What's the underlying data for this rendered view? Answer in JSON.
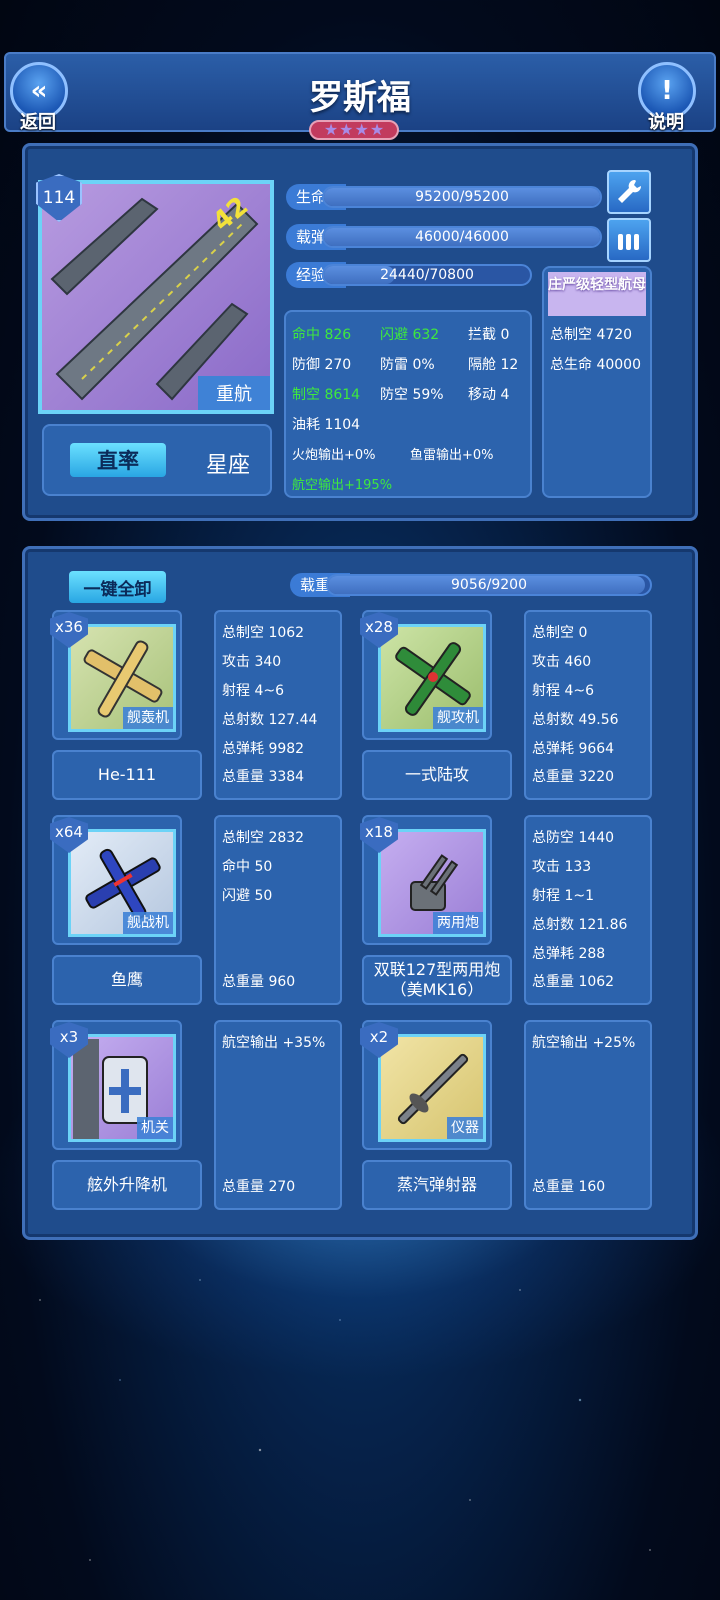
{
  "header": {
    "title": "罗斯福",
    "back_label": "返回",
    "help_label": "说明",
    "rating_stars": 4
  },
  "ship": {
    "level": "114",
    "type_tag": "重航",
    "hull_number": "42",
    "btn_ratio": "直率",
    "btn_constellation": "星座",
    "stats": {
      "hp_label": "生命",
      "hp_value": "95200/95200",
      "hp_fraction": 1.0,
      "ammo_label": "载弹",
      "ammo_value": "46000/46000",
      "ammo_fraction": 1.0,
      "exp_label": "经验",
      "exp_value": "24440/70800",
      "exp_fraction": 0.345
    },
    "attrs": {
      "hit": "命中 826",
      "dodge": "闪避 632",
      "intercept": "拦截 0",
      "defense": "防御 270",
      "torpedo_def": "防雷 0%",
      "bulkhead": "隔舱 12",
      "air_control": "制空 8614",
      "aa": "防空 59%",
      "move": "移动 4",
      "fuel": "油耗 1104",
      "gun_output": "火炮输出+0%",
      "torp_output": "鱼雷输出+0%",
      "air_output": "航空输出+195%"
    },
    "class_box": {
      "title": "庄严级轻型航母",
      "total_air": "总制空 4720",
      "total_hp": "总生命 40000"
    }
  },
  "equipment": {
    "unload_all": "一键全卸",
    "load_label": "载重",
    "load_value": "9056/9200",
    "load_fraction": 0.984,
    "slots": [
      {
        "qty": "x36",
        "tag": "舰轰机",
        "name": "He-111",
        "lines": [
          {
            "t": "总制空 1062",
            "c": "green"
          },
          {
            "t": "攻击 340",
            "c": ""
          },
          {
            "t": "射程 4~6",
            "c": ""
          },
          {
            "t": "总射数 127.44",
            "c": "green"
          },
          {
            "t": "总弹耗 9982",
            "c": "red"
          },
          {
            "t": "总重量 3384",
            "c": ""
          }
        ]
      },
      {
        "qty": "x28",
        "tag": "舰攻机",
        "name": "一式陆攻",
        "lines": [
          {
            "t": "总制空 0",
            "c": "green"
          },
          {
            "t": "攻击 460",
            "c": ""
          },
          {
            "t": "射程 4~6",
            "c": ""
          },
          {
            "t": "总射数 49.56",
            "c": "green"
          },
          {
            "t": "总弹耗 9664",
            "c": "red"
          },
          {
            "t": "总重量 3220",
            "c": ""
          }
        ]
      },
      {
        "qty": "x64",
        "tag": "舰战机",
        "name": "鱼鹰",
        "lines": [
          {
            "t": "总制空 2832",
            "c": "green"
          },
          {
            "t": "命中 50",
            "c": ""
          },
          {
            "t": "闪避 50",
            "c": ""
          },
          {
            "t": "",
            "c": ""
          },
          {
            "t": "",
            "c": ""
          },
          {
            "t": "总重量 960",
            "c": ""
          }
        ]
      },
      {
        "qty": "x18",
        "tag": "两用炮",
        "name": "双联127型两用炮（美MK16）",
        "lines": [
          {
            "t": "总防空 1440",
            "c": ""
          },
          {
            "t": "攻击 133",
            "c": ""
          },
          {
            "t": "射程 1~1",
            "c": ""
          },
          {
            "t": "总射数 121.86",
            "c": ""
          },
          {
            "t": "总弹耗 288",
            "c": ""
          },
          {
            "t": "总重量 1062",
            "c": ""
          }
        ]
      },
      {
        "qty": "x3",
        "tag": "机关",
        "name": "舷外升降机",
        "lines": [
          {
            "t": "航空输出 +35%",
            "c": ""
          },
          {
            "t": "",
            "c": ""
          },
          {
            "t": "",
            "c": ""
          },
          {
            "t": "",
            "c": ""
          },
          {
            "t": "",
            "c": ""
          },
          {
            "t": "总重量 270",
            "c": ""
          }
        ]
      },
      {
        "qty": "x2",
        "tag": "仪器",
        "name": "蒸汽弹射器",
        "lines": [
          {
            "t": "航空输出 +25%",
            "c": ""
          },
          {
            "t": "",
            "c": ""
          },
          {
            "t": "",
            "c": ""
          },
          {
            "t": "",
            "c": ""
          },
          {
            "t": "",
            "c": ""
          },
          {
            "t": "总重量 160",
            "c": ""
          }
        ]
      }
    ]
  }
}
